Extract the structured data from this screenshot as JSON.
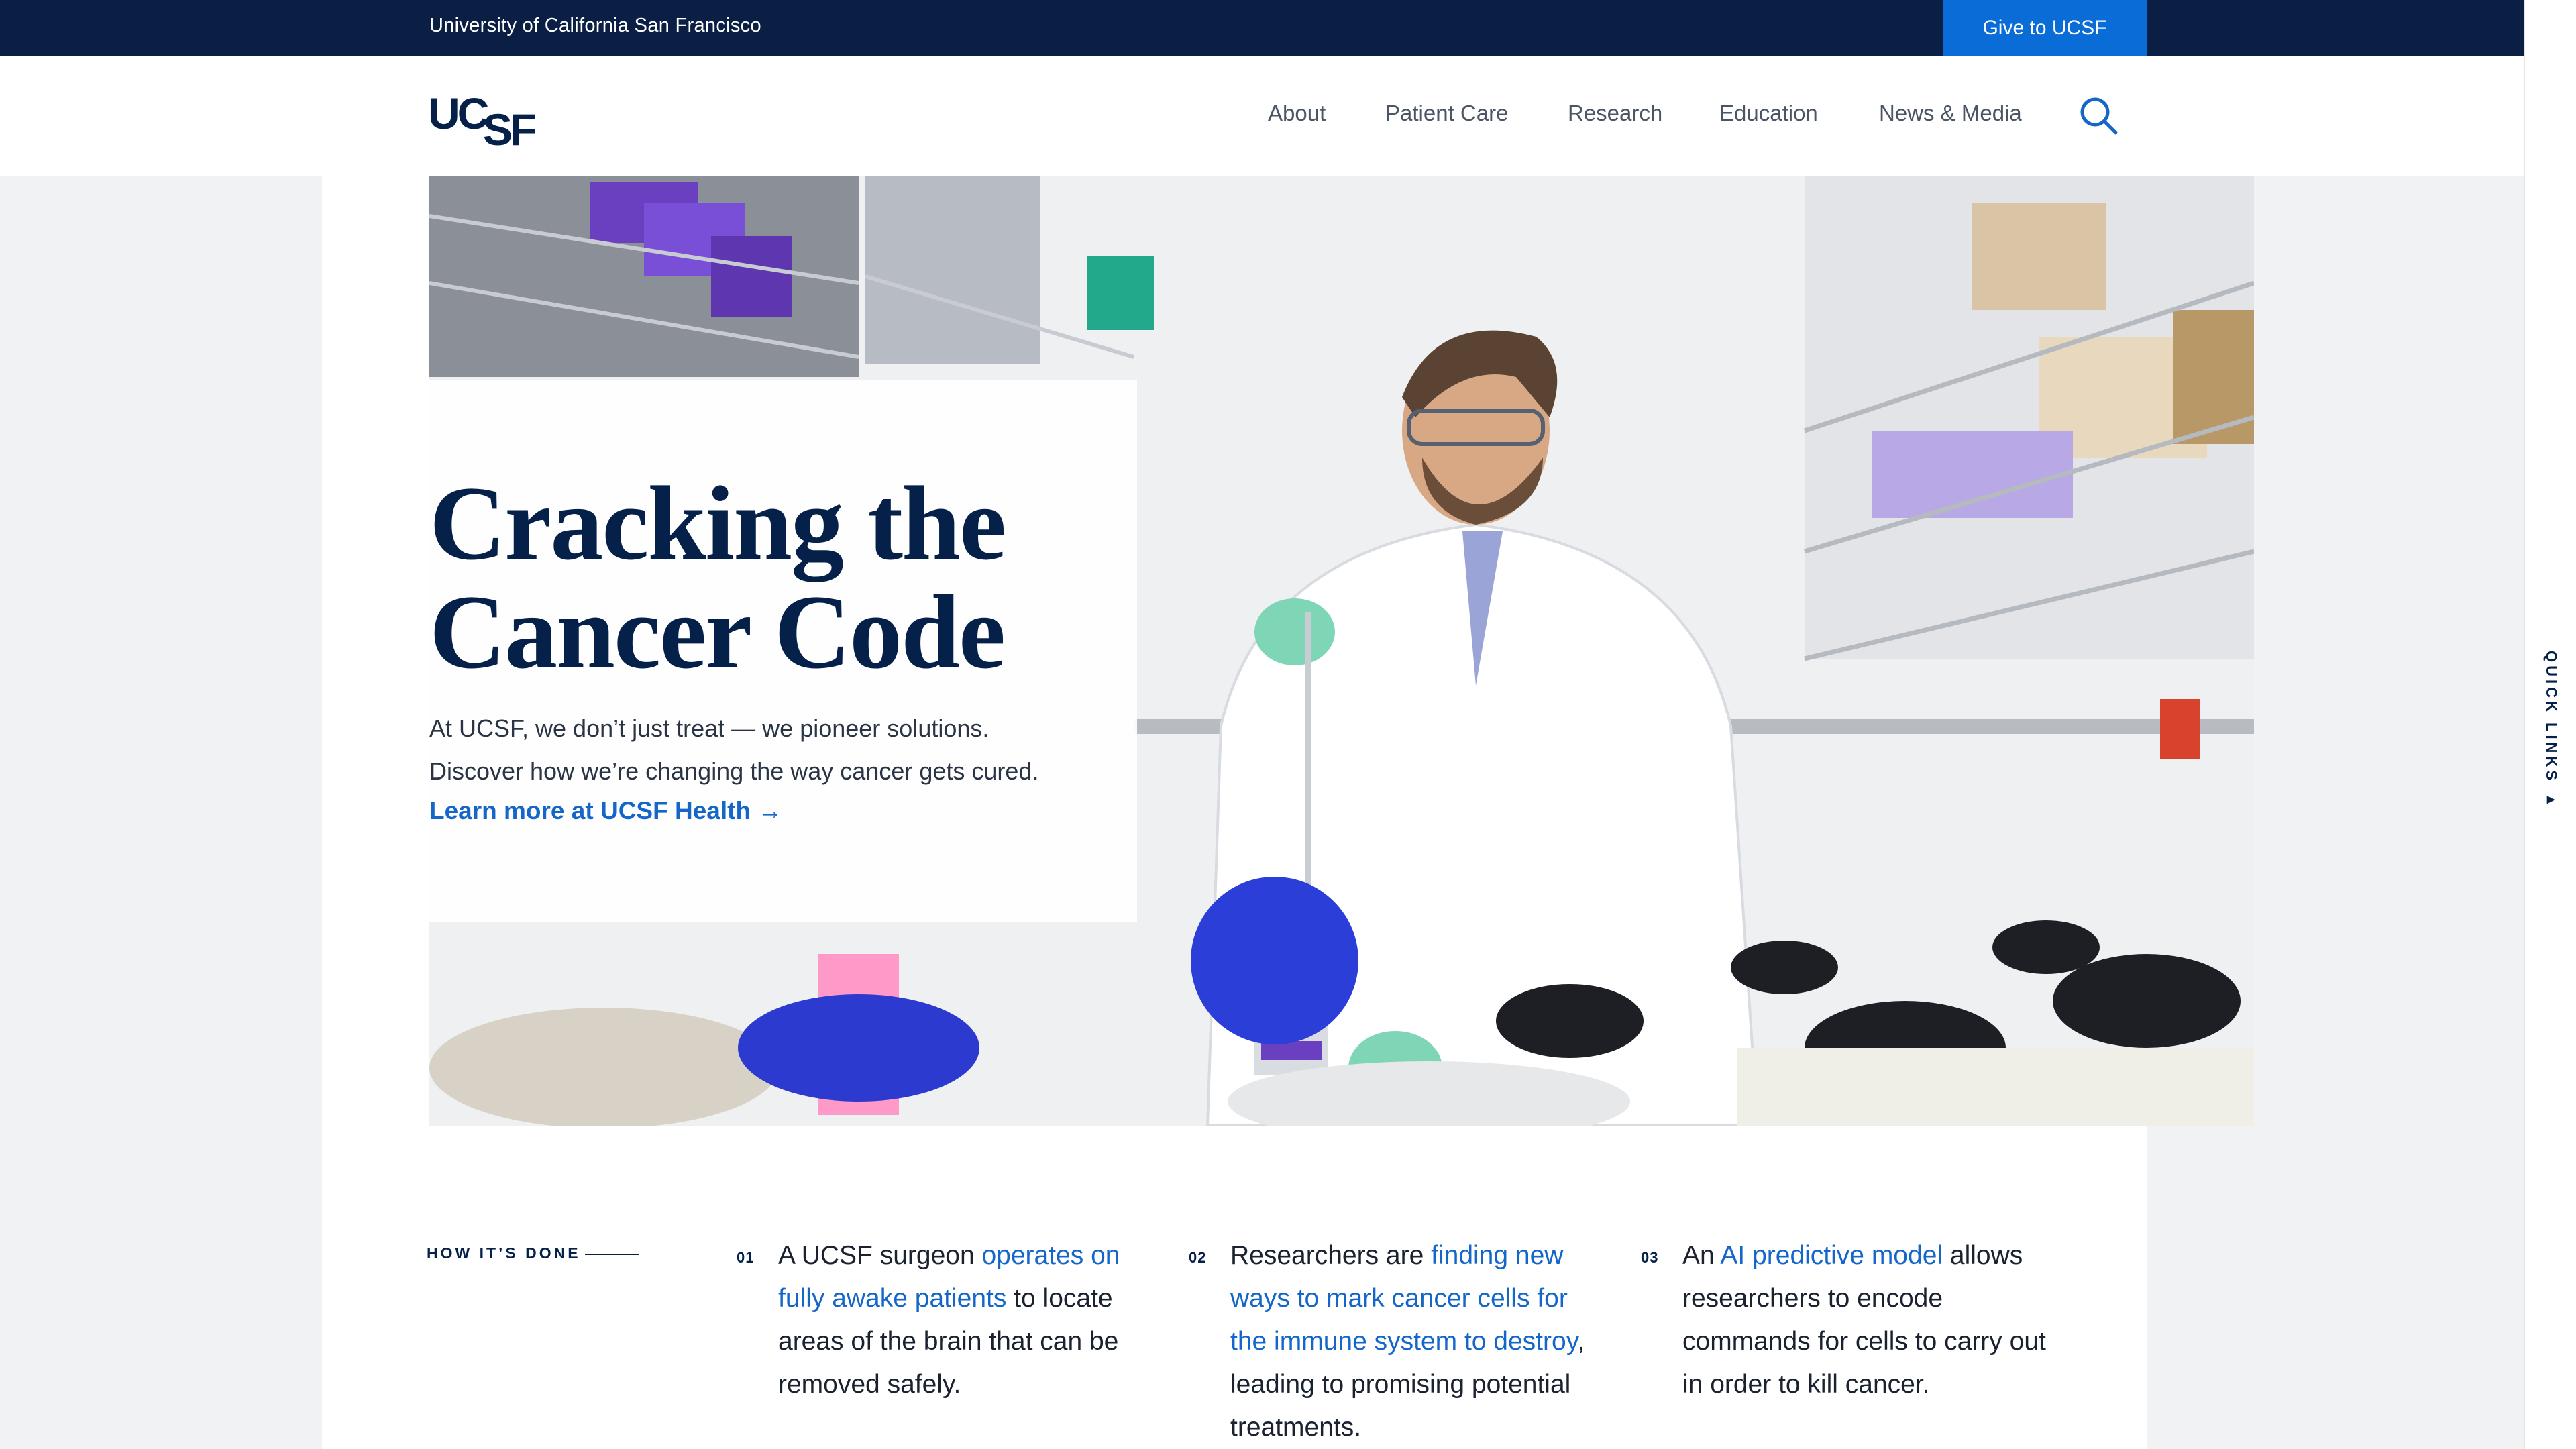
{
  "utility_bar": {
    "university": "University of California San Francisco",
    "give_button": "Give to UCSF"
  },
  "header": {
    "logo_text": "UCSF",
    "nav": [
      "About",
      "Patient Care",
      "Research",
      "Education",
      "News & Media"
    ],
    "search_icon": "search-icon"
  },
  "hero": {
    "title_line1": "Cracking the",
    "title_line2": "Cancer Code",
    "body_line1": "At UCSF, we don’t just treat — we pioneer solutions.",
    "body_line2": "Discover how we’re changing the way cancer gets cured.",
    "link": "Learn more at UCSF Health →"
  },
  "quick_links": {
    "label": "QUICK LINKS ▸"
  },
  "how": {
    "label": "HOW IT’S DONE",
    "steps": [
      {
        "num": "01",
        "pre": "A UCSF surgeon ",
        "link": "operates on fully awake patients",
        "post": " to locate areas of the brain that can be removed safely."
      },
      {
        "num": "02",
        "pre": "Researchers are ",
        "link": "finding new ways to mark cancer cells for the immune system to destroy",
        "post": ", leading to promising potential treatments."
      },
      {
        "num": "03",
        "pre": "An ",
        "link": "AI predictive model",
        "post": " allows researchers to encode commands for cells to carry out in order to kill cancer."
      }
    ]
  },
  "colors": {
    "navy": "#052049",
    "utility_bg": "#0b1f45",
    "accent_blue": "#0a6cd6",
    "link_blue": "#1467c9"
  }
}
